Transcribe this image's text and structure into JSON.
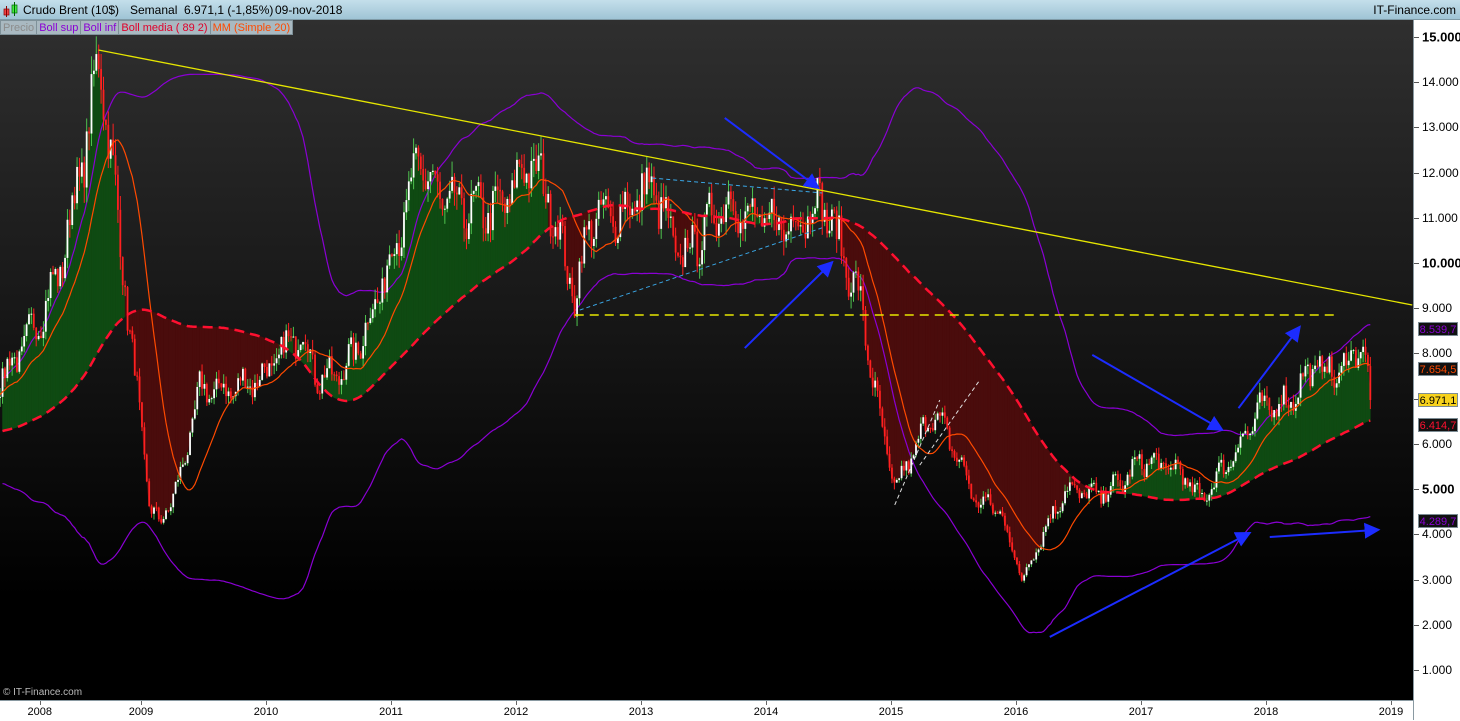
{
  "header": {
    "instrument": "Crudo Brent (10$)",
    "period": "Semanal",
    "quote": "6.971,1 (-1,85%)",
    "date": "09-nov-2018",
    "brand": "IT-Finance.com"
  },
  "legend": [
    {
      "label": "Precio",
      "color": "#8c8c8c"
    },
    {
      "label": "Boll sup",
      "color": "#8a00d4"
    },
    {
      "label": "Boll inf",
      "color": "#8a00d4"
    },
    {
      "label": "Boll media ( 89 2)",
      "color": "#e0002a"
    },
    {
      "label": "MM (Simple 20)",
      "color": "#ff4a00"
    }
  ],
  "copyright": "© IT-Finance.com",
  "value_boxes": [
    {
      "label": "8.539,7",
      "value": 8539.7,
      "color": "#8a00d4",
      "bg": "#111111"
    },
    {
      "label": "7.654,5",
      "value": 7654.5,
      "color": "#ff4a00",
      "bg": "#111111"
    },
    {
      "label": "6.971,1",
      "value": 6971.1,
      "color": "#000000",
      "bg": "#f7d21c"
    },
    {
      "label": "6.414,7",
      "value": 6414.7,
      "color": "#ff1030",
      "bg": "#111111"
    },
    {
      "label": "4.289,7",
      "value": 4289.7,
      "color": "#8a00d4",
      "bg": "#111111"
    }
  ],
  "chart_data": {
    "type": "candlestick",
    "title": "Crudo Brent (10$) Semanal",
    "ylim": [
      0,
      15300
    ],
    "xlim": [
      2007.87,
      2019.17
    ],
    "y_ticks": [
      {
        "v": 1000,
        "label": "1.000"
      },
      {
        "v": 2000,
        "label": "2.000"
      },
      {
        "v": 3000,
        "label": "3.000"
      },
      {
        "v": 4000,
        "label": "4.000"
      },
      {
        "v": 5000,
        "label": "5.000",
        "bold": true
      },
      {
        "v": 6000,
        "label": "6.000"
      },
      {
        "v": 7000,
        "label": "7.000"
      },
      {
        "v": 8000,
        "label": "8.000"
      },
      {
        "v": 9000,
        "label": "9.000"
      },
      {
        "v": 10000,
        "label": "10.000",
        "bold": true
      },
      {
        "v": 11000,
        "label": "11.000"
      },
      {
        "v": 12000,
        "label": "12.000"
      },
      {
        "v": 13000,
        "label": "13.000"
      },
      {
        "v": 14000,
        "label": "14.000"
      },
      {
        "v": 15000,
        "label": "15.000",
        "bold": true
      }
    ],
    "x_ticks": [
      {
        "v": 2008.19,
        "label": "2008"
      },
      {
        "v": 2009,
        "label": "2009"
      },
      {
        "v": 2010,
        "label": "2010"
      },
      {
        "v": 2011,
        "label": "2011"
      },
      {
        "v": 2012,
        "label": "2012"
      },
      {
        "v": 2013,
        "label": "2013"
      },
      {
        "v": 2014,
        "label": "2014"
      },
      {
        "v": 2015,
        "label": "2015"
      },
      {
        "v": 2016,
        "label": "2016"
      },
      {
        "v": 2017,
        "label": "2017"
      },
      {
        "v": 2018,
        "label": "2018"
      },
      {
        "v": 2019,
        "label": "2019"
      }
    ],
    "price_path": [
      [
        2006.2,
        6500
      ],
      [
        2006.8,
        5800
      ],
      [
        2007.2,
        5600
      ],
      [
        2007.6,
        7000
      ],
      [
        2007.91,
        7520
      ],
      [
        2008.18,
        8740
      ],
      [
        2008.35,
        9850
      ],
      [
        2008.55,
        12500
      ],
      [
        2008.67,
        14600
      ],
      [
        2008.79,
        11600
      ],
      [
        2008.91,
        8520
      ],
      [
        2009.02,
        5870
      ],
      [
        2009.07,
        4650
      ],
      [
        2009.15,
        4200
      ],
      [
        2009.31,
        5200
      ],
      [
        2009.47,
        7190
      ],
      [
        2009.71,
        7190
      ],
      [
        2009.99,
        7520
      ],
      [
        2010.27,
        8520
      ],
      [
        2010.43,
        7410
      ],
      [
        2010.63,
        7630
      ],
      [
        2010.83,
        8740
      ],
      [
        2011.07,
        10730
      ],
      [
        2011.23,
        12280
      ],
      [
        2011.39,
        11400
      ],
      [
        2011.59,
        11180
      ],
      [
        2011.87,
        11180
      ],
      [
        2012.11,
        12280
      ],
      [
        2012.27,
        11400
      ],
      [
        2012.47,
        9190
      ],
      [
        2012.59,
        10960
      ],
      [
        2012.83,
        11070
      ],
      [
        2013.09,
        11730
      ],
      [
        2013.31,
        10070
      ],
      [
        2013.51,
        10730
      ],
      [
        2013.67,
        11400
      ],
      [
        2013.87,
        10960
      ],
      [
        2014.19,
        10840
      ],
      [
        2014.45,
        11400
      ],
      [
        2014.59,
        10400
      ],
      [
        2014.75,
        9190
      ],
      [
        2014.91,
        6530
      ],
      [
        2015.03,
        4980
      ],
      [
        2015.23,
        6090
      ],
      [
        2015.33,
        6750
      ],
      [
        2015.51,
        5870
      ],
      [
        2015.67,
        4760
      ],
      [
        2015.87,
        4540
      ],
      [
        2016.05,
        2990
      ],
      [
        2016.19,
        3870
      ],
      [
        2016.39,
        4980
      ],
      [
        2016.67,
        4870
      ],
      [
        2016.87,
        5200
      ],
      [
        2017.0,
        5640
      ],
      [
        2017.31,
        5420
      ],
      [
        2017.47,
        4760
      ],
      [
        2017.71,
        5640
      ],
      [
        2017.95,
        6750
      ],
      [
        2018.19,
        6970
      ],
      [
        2018.39,
        7740
      ],
      [
        2018.59,
        7520
      ],
      [
        2018.75,
        8300
      ],
      [
        2018.85,
        6971
      ]
    ],
    "indicators": {
      "bollinger": {
        "period": 89,
        "std": 2
      },
      "sma": 20
    },
    "annotations": {
      "trendline": {
        "from": [
          2008.66,
          14712
        ],
        "to": [
          2019.17,
          9072
        ],
        "color": "#e6e600"
      },
      "support_dashed": {
        "from": [
          2012.47,
          8850
        ],
        "to": [
          2018.55,
          8850
        ],
        "color": "#e6e600"
      },
      "triangle": [
        {
          "from": [
            2013.09,
            11880
          ],
          "to": [
            2014.45,
            11550
          ]
        },
        {
          "from": [
            2012.51,
            8960
          ],
          "to": [
            2014.45,
            10780
          ]
        }
      ],
      "channel": [
        {
          "from": [
            2015.03,
            4650
          ],
          "to": [
            2015.39,
            6970
          ]
        },
        {
          "from": [
            2015.23,
            5530
          ],
          "to": [
            2015.71,
            7410
          ]
        }
      ],
      "arrows": [
        {
          "from": [
            2013.67,
            13210
          ],
          "to": [
            2014.42,
            11660
          ]
        },
        {
          "from": [
            2013.83,
            8120
          ],
          "to": [
            2014.53,
            10020
          ]
        },
        {
          "from": [
            2016.61,
            7970
          ],
          "to": [
            2017.65,
            6310
          ]
        },
        {
          "from": [
            2017.78,
            6790
          ],
          "to": [
            2018.27,
            8590
          ]
        },
        {
          "from": [
            2016.27,
            1730
          ],
          "to": [
            2017.87,
            4030
          ]
        },
        {
          "from": [
            2018.03,
            3940
          ],
          "to": [
            2018.9,
            4100
          ]
        }
      ]
    }
  }
}
